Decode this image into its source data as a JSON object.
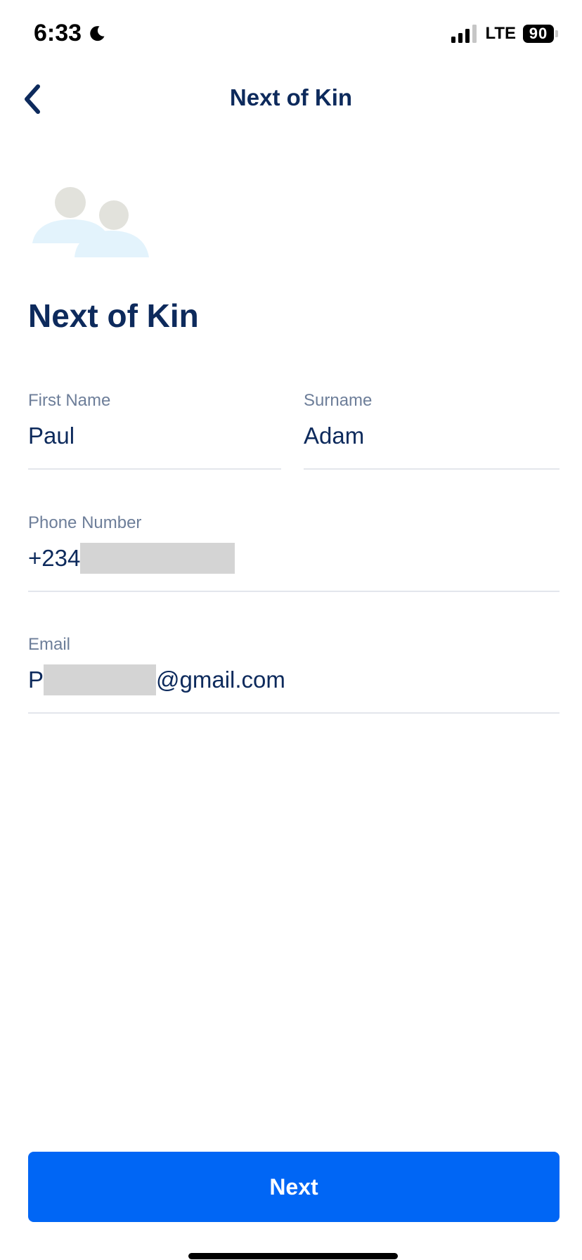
{
  "status_bar": {
    "time": "6:33",
    "network": "LTE",
    "battery": "90"
  },
  "header": {
    "title": "Next of Kin"
  },
  "main": {
    "title": "Next of Kin",
    "fields": {
      "first_name": {
        "label": "First Name",
        "value": "Paul"
      },
      "surname": {
        "label": "Surname",
        "value": "Adam"
      },
      "phone": {
        "label": "Phone Number",
        "value_prefix": "+234"
      },
      "email": {
        "label": "Email",
        "value_prefix": "P",
        "value_suffix": "@gmail.com"
      }
    }
  },
  "footer": {
    "next_label": "Next"
  },
  "colors": {
    "primary": "#0066f5",
    "text_dark": "#0d2a5c",
    "label_gray": "#6d7e99",
    "divider": "#e3e6ec",
    "redaction": "#d4d4d4"
  }
}
